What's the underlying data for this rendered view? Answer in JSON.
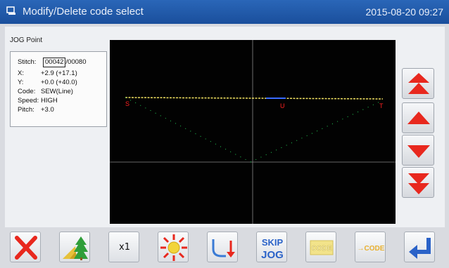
{
  "window": {
    "title": "Modify/Delete code select",
    "datetime": "2015-08-20 09:27"
  },
  "section_label": "JOG Point",
  "info": {
    "stitch_label": "Stitch:",
    "stitch_current": "00042",
    "stitch_total": "/00080",
    "x_label": "X:",
    "x_value": "+2.9 (+17.1)",
    "y_label": "Y:",
    "y_value": "+0.0 (+40.0)",
    "code_label": "Code:",
    "code_value": "SEW(Line)",
    "speed_label": "Speed:",
    "speed_value": "HIGH",
    "pitch_label": "Pitch:",
    "pitch_value": "+3.0"
  },
  "canvas": {
    "markers": {
      "start": "S",
      "jog": "U",
      "end": "T"
    },
    "colors": {
      "seam_line": "#f0e060",
      "stitch_path": "#22cc55",
      "marker": "#ff2020",
      "crosshair": "#9a9a9a",
      "jog_segment": "#3a6bff"
    }
  },
  "side_buttons": [
    {
      "name": "fast-up",
      "icon": "double-arrow-up"
    },
    {
      "name": "step-up",
      "icon": "arrow-up"
    },
    {
      "name": "step-down",
      "icon": "arrow-down"
    },
    {
      "name": "fast-down",
      "icon": "double-arrow-down"
    }
  ],
  "toolbar": {
    "x1_label": "x1",
    "skip_jog_line1": "SKIP",
    "skip_jog_line2": "JOG",
    "code_label": "CODE",
    "to_code_label": "→CODE"
  },
  "theme": {
    "title_bar": "#1f58a8",
    "arrow_red": "#e8281e"
  }
}
